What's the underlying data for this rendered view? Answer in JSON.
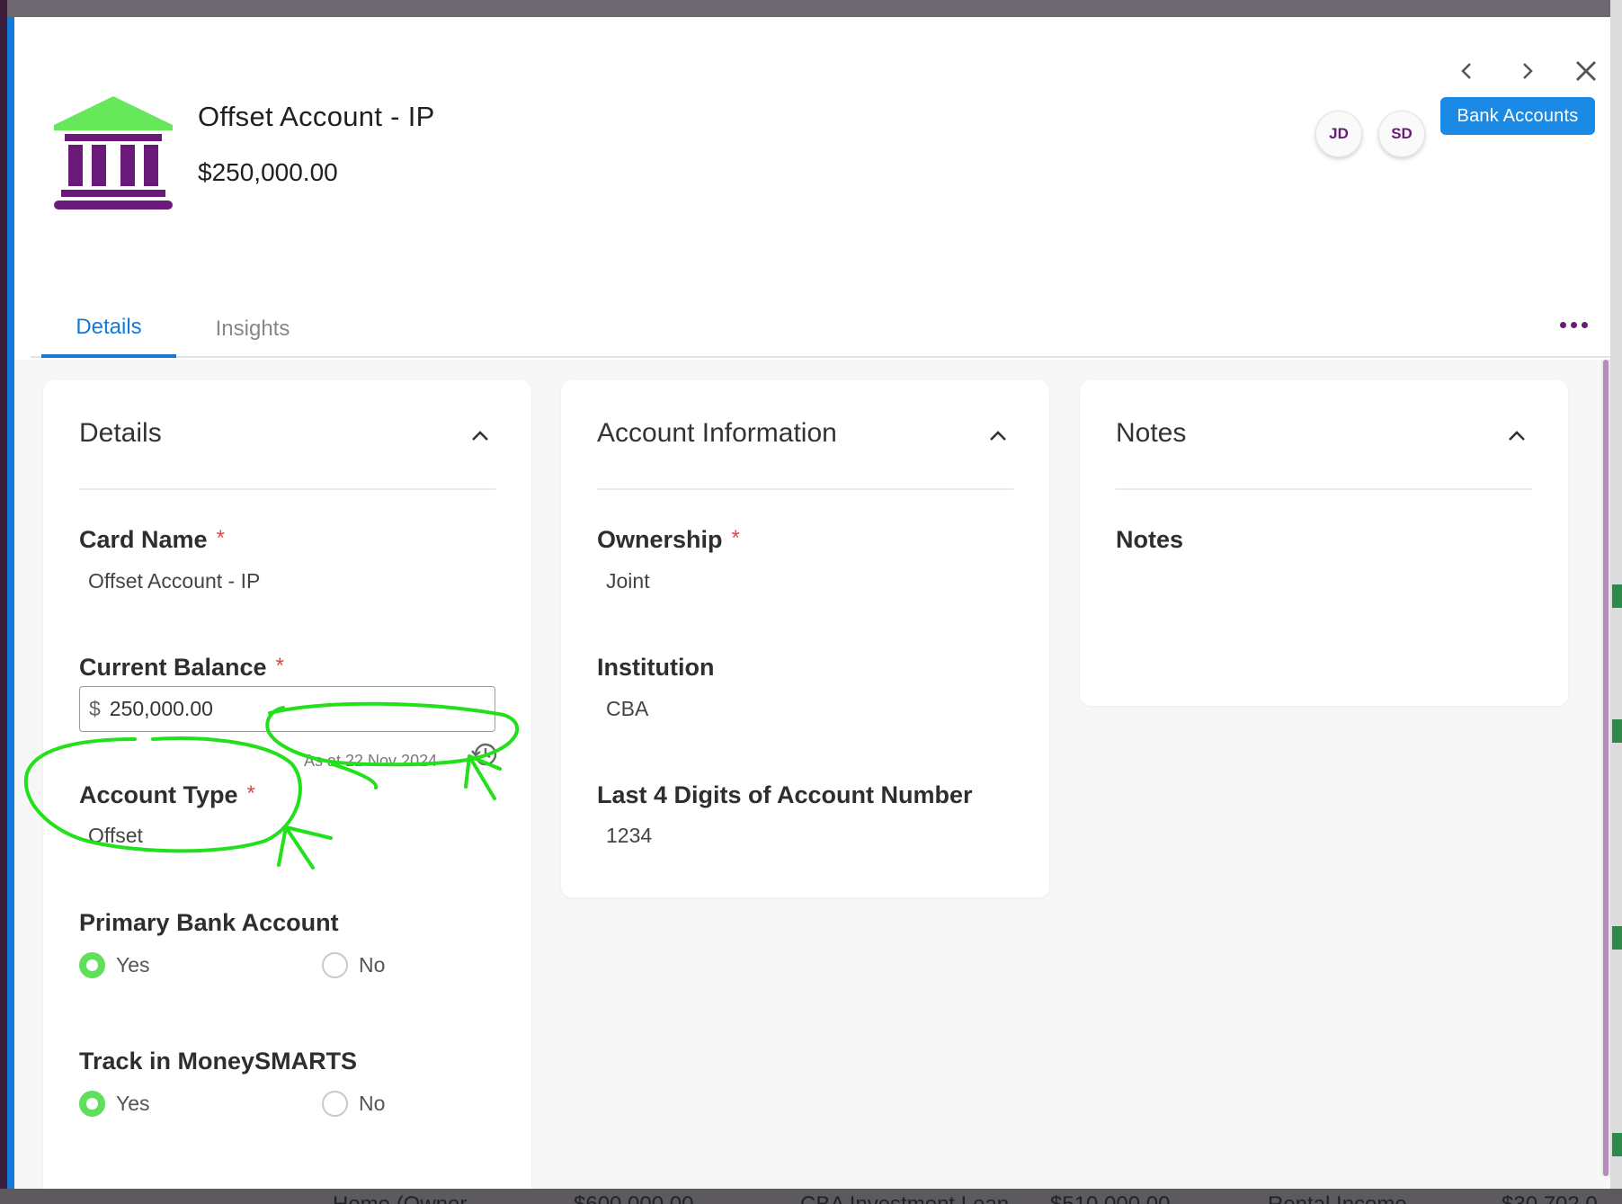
{
  "window": {
    "title": "Offset Account - IP",
    "amount": "$250,000.00",
    "tag_button": "Bank Accounts",
    "avatars": [
      "JD",
      "SD"
    ]
  },
  "tabs": [
    {
      "label": "Details",
      "active": true
    },
    {
      "label": "Insights",
      "active": false
    }
  ],
  "details_card": {
    "title": "Details",
    "card_name": {
      "label": "Card Name",
      "required": "*",
      "value": "Offset Account - IP"
    },
    "current_balance": {
      "label": "Current Balance",
      "required": "*",
      "prefix": "$",
      "value": "250,000.00",
      "as_at": "As at 22 Nov 2024"
    },
    "account_type": {
      "label": "Account Type",
      "required": "*",
      "value": "Offset"
    },
    "primary_bank": {
      "label": "Primary Bank Account",
      "options": [
        "Yes",
        "No"
      ],
      "selected": "Yes"
    },
    "track_moneysmarts": {
      "label": "Track in MoneySMARTS",
      "options": [
        "Yes",
        "No"
      ],
      "selected": "Yes"
    }
  },
  "account_card": {
    "title": "Account Information",
    "ownership": {
      "label": "Ownership",
      "required": "*",
      "value": "Joint"
    },
    "institution": {
      "label": "Institution",
      "value": "CBA"
    },
    "last4": {
      "label": "Last 4 Digits of Account Number",
      "value": "1234"
    }
  },
  "notes_card": {
    "title": "Notes",
    "notes_label": "Notes"
  },
  "background": {
    "ghost_texts": [
      "Home (Owner",
      "$600,000.00",
      "CBA Investment Loan",
      "$510,000.00",
      "Rental Income",
      "$30,702.0"
    ]
  },
  "colors": {
    "accent_blue": "#1479d9",
    "button_blue": "#1a8ae6",
    "purple": "#6a1b7a",
    "icon_green": "#66e85a",
    "radio_green": "#60e05a",
    "required_red": "#e04545",
    "annotation_green": "#22e01a"
  },
  "icons": [
    "bank-building-icon",
    "chevron-left-icon",
    "chevron-right-icon",
    "close-icon",
    "more-dots-icon",
    "chevron-up-icon",
    "history-icon"
  ]
}
